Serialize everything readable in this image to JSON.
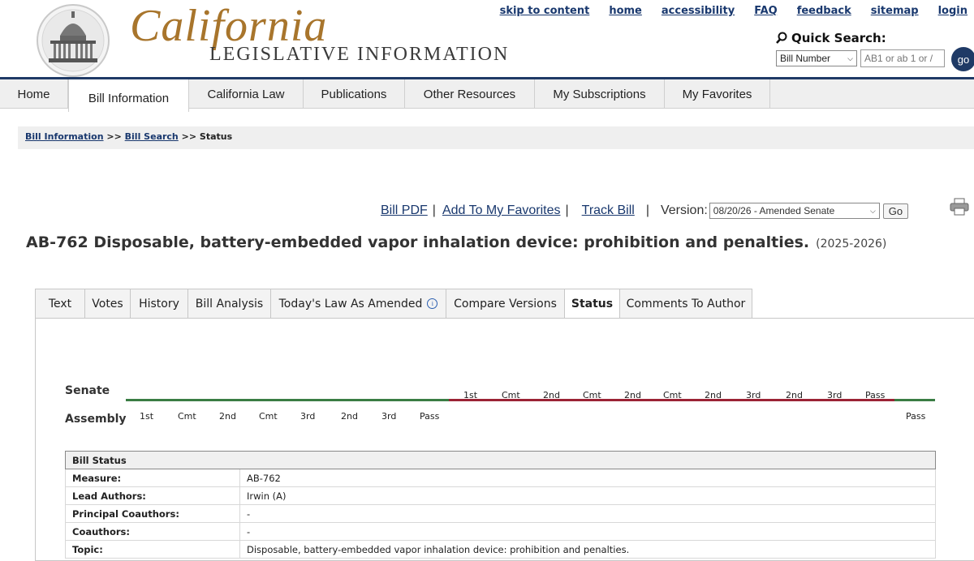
{
  "header": {
    "logo_script": "California",
    "logo_sub": "LEGISLATIVE INFORMATION",
    "top_links": [
      "skip to content",
      "home",
      "accessibility",
      "FAQ",
      "feedback",
      "sitemap",
      "login"
    ],
    "quick_search": {
      "label": "Quick Search:",
      "select_value": "Bill Number",
      "input_placeholder": "AB1 or ab 1 or /",
      "go_label": "go"
    }
  },
  "nav": {
    "tabs": [
      "Home",
      "Bill Information",
      "California Law",
      "Publications",
      "Other Resources",
      "My Subscriptions",
      "My Favorites"
    ],
    "active": "Bill Information"
  },
  "breadcrumb": {
    "items": [
      "Bill Information",
      "Bill Search",
      "Status"
    ],
    "separator": ">>"
  },
  "bill_actions": {
    "pdf": "Bill PDF",
    "favorites": "Add To My Favorites",
    "track": "Track Bill",
    "version_label": "Version:",
    "version_value": "08/20/26 - Amended Senate",
    "go_label": "Go",
    "sep": "|"
  },
  "bill": {
    "title": "AB-762 Disposable, battery-embedded vapor inhalation device: prohibition and penalties.",
    "session": "(2025-2026)"
  },
  "content_tabs": {
    "items": [
      "Text",
      "Votes",
      "History",
      "Bill Analysis",
      "Today's Law As Amended",
      "Compare Versions",
      "Status",
      "Comments To Author"
    ],
    "active": "Status",
    "info_icon": "info-icon"
  },
  "timeline": {
    "senate_label": "Senate",
    "assembly_label": "Assembly",
    "senate_steps": [
      "1st",
      "Cmt",
      "2nd",
      "Cmt",
      "2nd",
      "Cmt",
      "2nd",
      "3rd",
      "2nd",
      "3rd",
      "Pass"
    ],
    "assembly_steps": [
      "1st",
      "Cmt",
      "2nd",
      "Cmt",
      "3rd",
      "2nd",
      "3rd",
      "Pass"
    ],
    "final_step": "Pass",
    "colors": {
      "completed": "#3a7d44",
      "pending": "#9b2335"
    }
  },
  "status_table": {
    "header": "Bill Status",
    "rows": [
      {
        "key": "Measure:",
        "value": "AB-762"
      },
      {
        "key": "Lead Authors:",
        "value": "Irwin (A)"
      },
      {
        "key": "Principal Coauthors:",
        "value": "-"
      },
      {
        "key": "Coauthors:",
        "value": "-"
      },
      {
        "key": "Topic:",
        "value": "Disposable, battery-embedded vapor inhalation device: prohibition and penalties."
      }
    ]
  },
  "colors": {
    "brand_navy": "#1f3a66",
    "link": "#19386e",
    "logo_gold": "#a8752c"
  }
}
